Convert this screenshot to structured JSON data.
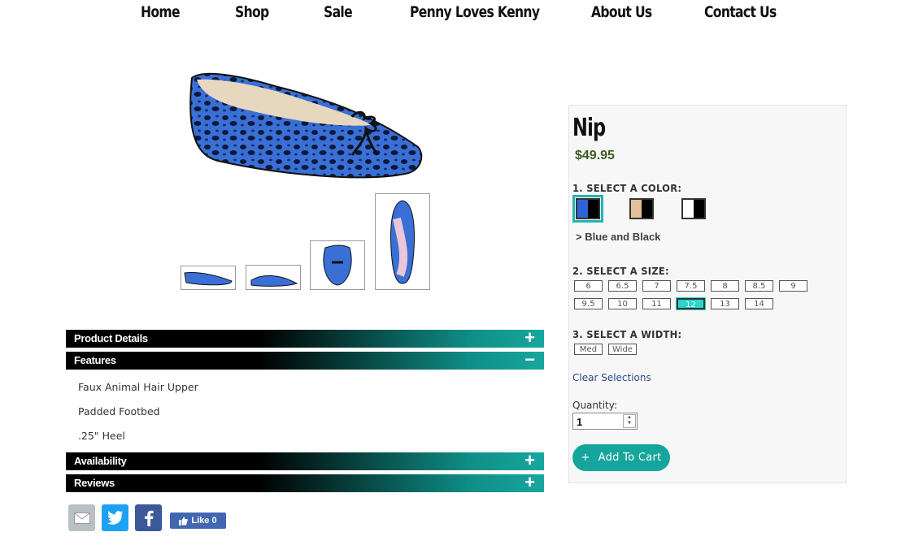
{
  "nav": {
    "items": [
      "Home",
      "Shop",
      "Sale",
      "Penny Loves Kenny",
      "About Us",
      "Contact Us"
    ]
  },
  "product": {
    "name": "Nip",
    "price": "$49.95",
    "color_label": "1. SELECT A COLOR:",
    "colors": [
      {
        "name": "blue-black",
        "left": "#2f63d8",
        "right": "#000000"
      },
      {
        "name": "tan-black",
        "left": "#e1c09a",
        "right": "#000000"
      },
      {
        "name": "white-black",
        "left": "#ffffff",
        "right": "#000000"
      }
    ],
    "selected_color": "> Blue and Black",
    "size_label": "2. SELECT A SIZE:",
    "sizes": [
      "6",
      "6.5",
      "7",
      "7.5",
      "8",
      "8.5",
      "9",
      "9.5",
      "10",
      "11",
      "12",
      "13",
      "14"
    ],
    "selected_size": "12",
    "width_label": "3. SELECT A WIDTH:",
    "widths": [
      "Med",
      "Wide"
    ],
    "clear": "Clear Selections",
    "quantity_label": "Quantity:",
    "quantity": "1",
    "add_to_cart": "Add To Cart",
    "add_icon": "+"
  },
  "accordion": {
    "product_details": {
      "title": "Product Details",
      "sign": "+"
    },
    "features": {
      "title": "Features",
      "sign": "−",
      "items": [
        "Faux Animal Hair Upper",
        "Padded Footbed",
        ".25\" Heel"
      ]
    },
    "availability": {
      "title": "Availability",
      "sign": "+"
    },
    "reviews": {
      "title": "Reviews",
      "sign": "+"
    }
  },
  "social": {
    "like": "Like 0",
    "colors": {
      "email": "#b9c0c3",
      "twitter": "#1da1f2",
      "facebook": "#3b5998"
    }
  }
}
